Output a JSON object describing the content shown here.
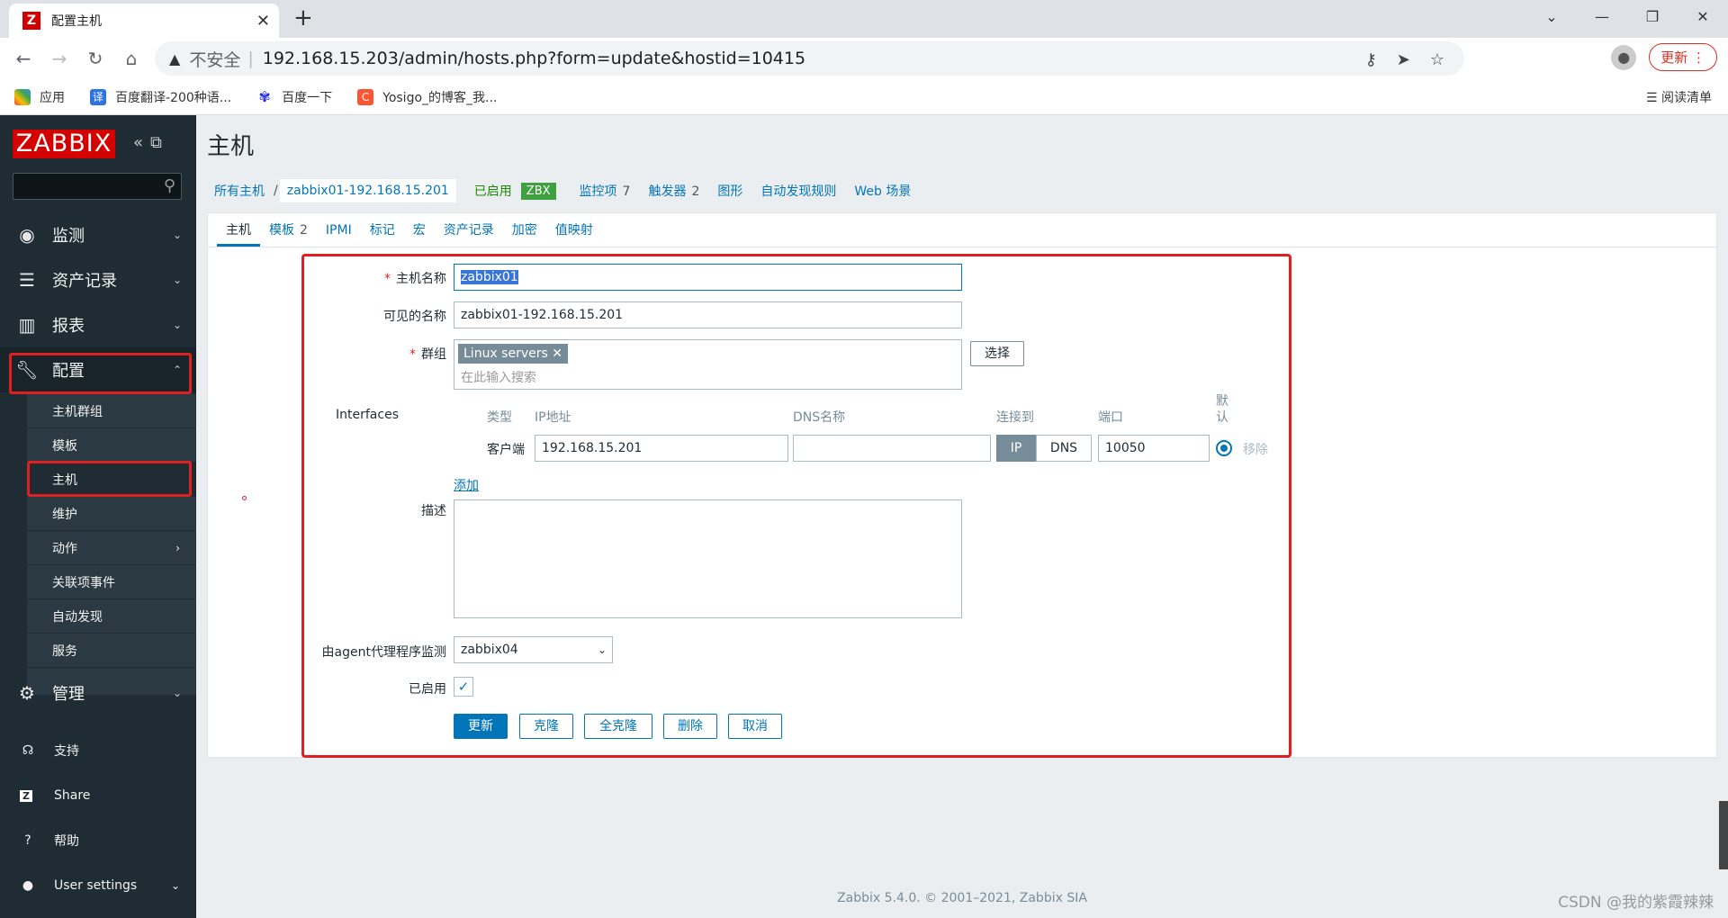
{
  "browser": {
    "tab_title": "配置主机",
    "url": "192.168.15.203/admin/hosts.php?form=update&hostid=10415",
    "insecure_label": "不安全",
    "update_label": "更新",
    "bookmarks": [
      "应用",
      "百度翻译-200种语...",
      "百度一下",
      "Yosigo_的博客_我..."
    ],
    "reading_list": "阅读清单"
  },
  "sidebar": {
    "logo": "ZABBIX",
    "menu": [
      {
        "label": "监测",
        "icon": "eye-icon"
      },
      {
        "label": "资产记录",
        "icon": "list-icon"
      },
      {
        "label": "报表",
        "icon": "chart-icon"
      },
      {
        "label": "配置",
        "icon": "wrench-icon"
      },
      {
        "label": "管理",
        "icon": "gear-icon"
      }
    ],
    "config_sub": [
      "主机群组",
      "模板",
      "主机",
      "维护",
      "动作",
      "关联项事件",
      "自动发现",
      "服务"
    ],
    "lower": [
      {
        "label": "支持",
        "icon": "headset-icon"
      },
      {
        "label": "Share",
        "icon": "share-icon"
      },
      {
        "label": "帮助",
        "icon": "help-icon"
      },
      {
        "label": "User settings",
        "icon": "user-icon"
      }
    ]
  },
  "page": {
    "title": "主机",
    "breadcrumb": {
      "all_hosts": "所有主机",
      "host": "zabbix01-192.168.15.201",
      "status": "已启用",
      "zbx": "ZBX",
      "items": "监控项",
      "items_count": "7",
      "triggers": "触发器",
      "triggers_count": "2",
      "graphs": "图形",
      "discovery": "自动发现规则",
      "web": "Web 场景"
    },
    "tabs": [
      {
        "label": "主机"
      },
      {
        "label": "模板",
        "count": "2"
      },
      {
        "label": "IPMI"
      },
      {
        "label": "标记"
      },
      {
        "label": "宏"
      },
      {
        "label": "资产记录"
      },
      {
        "label": "加密"
      },
      {
        "label": "值映射"
      }
    ]
  },
  "form": {
    "host_name_label": "主机名称",
    "host_name_value": "zabbix01",
    "visible_name_label": "可见的名称",
    "visible_name_value": "zabbix01-192.168.15.201",
    "groups_label": "群组",
    "group_tag": "Linux servers",
    "groups_placeholder": "在此输入搜索",
    "select_button": "选择",
    "interfaces_label": "Interfaces",
    "iface_headers": {
      "type": "类型",
      "ip": "IP地址",
      "dns": "DNS名称",
      "connect": "连接到",
      "port": "端口",
      "default": "默认"
    },
    "iface_row": {
      "type": "客户端",
      "ip": "192.168.15.201",
      "dns": "",
      "ip_btn": "IP",
      "dns_btn": "DNS",
      "port": "10050",
      "remove": "移除"
    },
    "add_link": "添加",
    "description_label": "描述",
    "proxy_label": "由agent代理程序监测",
    "proxy_value": "zabbix04",
    "enabled_label": "已启用",
    "buttons": {
      "update": "更新",
      "clone": "克隆",
      "full_clone": "全克隆",
      "delete": "删除",
      "cancel": "取消"
    }
  },
  "footer": {
    "text": "Zabbix 5.4.0. © 2001–2021,",
    "link": "Zabbix SIA"
  },
  "watermark": "CSDN @我的紫霞辣辣",
  "colors": {
    "sidebar": "#1f2c33",
    "accent": "#0275b8",
    "logo": "#d40000",
    "highlight": "#e02020"
  }
}
